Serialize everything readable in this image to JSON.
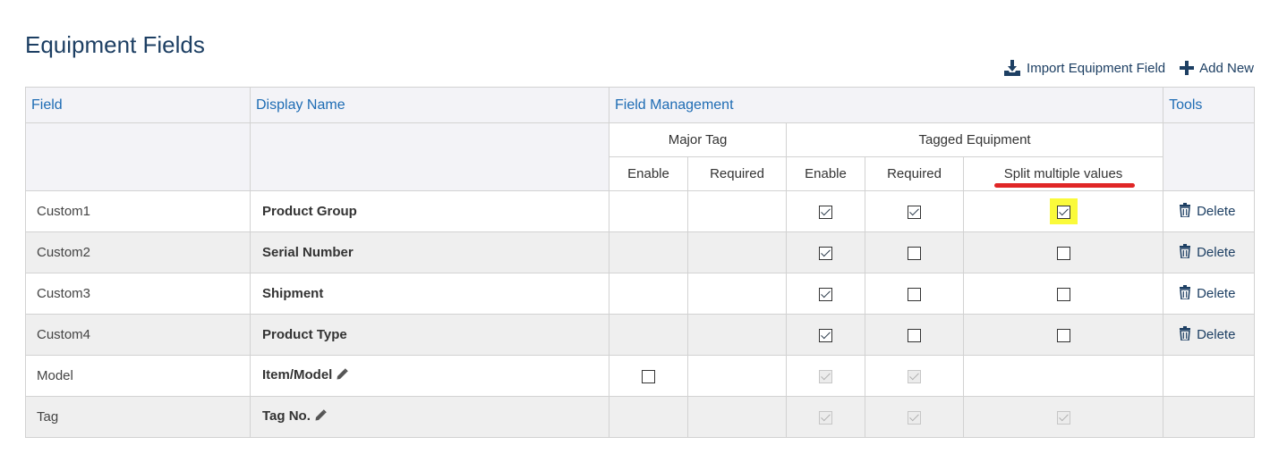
{
  "page": {
    "title": "Equipment Fields",
    "accent_color": "#1e6cb4",
    "title_color": "#1d3f63",
    "highlight_color": "#fafa3a",
    "annotation_color": "#e02626"
  },
  "actions": {
    "import_label": "Import Equipment Field",
    "import_icon": "download-icon",
    "add_label": "Add New",
    "add_icon": "plus-icon"
  },
  "table": {
    "headers": {
      "field": "Field",
      "display_name": "Display Name",
      "field_management": "Field Management",
      "tools": "Tools"
    },
    "groups": {
      "major_tag": "Major Tag",
      "tagged_equipment": "Tagged Equipment"
    },
    "subheaders": {
      "mt_enable": "Enable",
      "mt_required": "Required",
      "te_enable": "Enable",
      "te_required": "Required",
      "te_split": "Split multiple values"
    },
    "delete_label": "Delete",
    "rows": [
      {
        "field": "Custom1",
        "display": "Product Group",
        "editable_name": false,
        "mt_enable": null,
        "mt_required": null,
        "te_enable": {
          "checked": true,
          "disabled": false
        },
        "te_required": {
          "checked": true,
          "disabled": false
        },
        "te_split": {
          "checked": true,
          "disabled": false,
          "highlighted": true
        },
        "deletable": true
      },
      {
        "field": "Custom2",
        "display": "Serial Number",
        "editable_name": false,
        "mt_enable": null,
        "mt_required": null,
        "te_enable": {
          "checked": true,
          "disabled": false
        },
        "te_required": {
          "checked": false,
          "disabled": false
        },
        "te_split": {
          "checked": false,
          "disabled": false
        },
        "deletable": true
      },
      {
        "field": "Custom3",
        "display": "Shipment",
        "editable_name": false,
        "mt_enable": null,
        "mt_required": null,
        "te_enable": {
          "checked": true,
          "disabled": false
        },
        "te_required": {
          "checked": false,
          "disabled": false
        },
        "te_split": {
          "checked": false,
          "disabled": false
        },
        "deletable": true
      },
      {
        "field": "Custom4",
        "display": "Product Type",
        "editable_name": false,
        "mt_enable": null,
        "mt_required": null,
        "te_enable": {
          "checked": true,
          "disabled": false
        },
        "te_required": {
          "checked": false,
          "disabled": false
        },
        "te_split": {
          "checked": false,
          "disabled": false
        },
        "deletable": true
      },
      {
        "field": "Model",
        "display": "Item/Model",
        "editable_name": true,
        "mt_enable": {
          "checked": false,
          "disabled": false
        },
        "mt_required": null,
        "te_enable": {
          "checked": true,
          "disabled": true
        },
        "te_required": {
          "checked": true,
          "disabled": true
        },
        "te_split": null,
        "deletable": false
      },
      {
        "field": "Tag",
        "display": "Tag No.",
        "editable_name": true,
        "mt_enable": null,
        "mt_required": null,
        "te_enable": {
          "checked": true,
          "disabled": true
        },
        "te_required": {
          "checked": true,
          "disabled": true
        },
        "te_split": {
          "checked": true,
          "disabled": true
        },
        "deletable": false
      }
    ]
  }
}
